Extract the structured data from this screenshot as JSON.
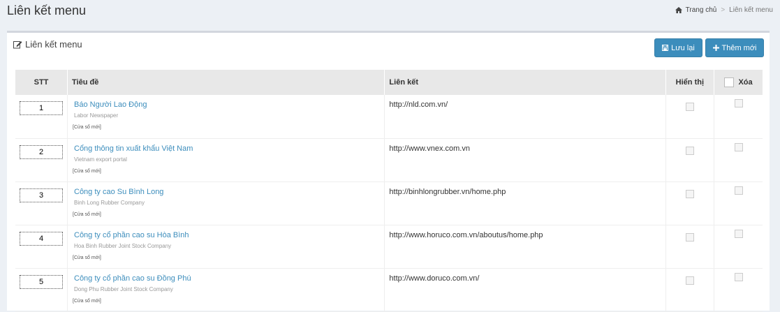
{
  "header": {
    "title": "Liên kết menu",
    "breadcrumb": {
      "home": "Trang chủ",
      "separator": ">",
      "current": "Liên kết menu"
    }
  },
  "box": {
    "title": "Liên kết menu",
    "save_label": "Lưu lại",
    "add_label": "Thêm mới"
  },
  "table": {
    "columns": {
      "stt": "STT",
      "title": "Tiêu đề",
      "link": "Liên kết",
      "visible": "Hiển thị",
      "delete": "Xóa"
    },
    "rows": [
      {
        "stt": "1",
        "title": "Báo Người Lao Động",
        "subtitle": "Labor Newspaper",
        "target": "[Cửa sổ mới]",
        "url": "http://nld.com.vn/"
      },
      {
        "stt": "2",
        "title": "Cổng thông tin xuất khẩu Việt Nam",
        "subtitle": "Vietnam export portal",
        "target": "[Cửa sổ mới]",
        "url": "http://www.vnex.com.vn"
      },
      {
        "stt": "3",
        "title": "Công ty cao Su Bình Long",
        "subtitle": "Binh Long Rubber Company",
        "target": "[Cửa sổ mới]",
        "url": "http://binhlongrubber.vn/home.php"
      },
      {
        "stt": "4",
        "title": "Công ty cổ phần cao su Hòa Bình",
        "subtitle": "Hoa Binh Rubber Joint Stock Company",
        "target": "[Cửa sổ mới]",
        "url": "http://www.horuco.com.vn/aboutus/home.php"
      },
      {
        "stt": "5",
        "title": "Công ty cổ phần cao su Đồng Phú",
        "subtitle": "Dong Phu Rubber Joint Stock Company",
        "target": "[Cửa sổ mới]",
        "url": "http://www.doruco.com.vn/"
      }
    ]
  },
  "colors": {
    "accent": "#3c8dbc",
    "background": "#ecf0f5"
  }
}
